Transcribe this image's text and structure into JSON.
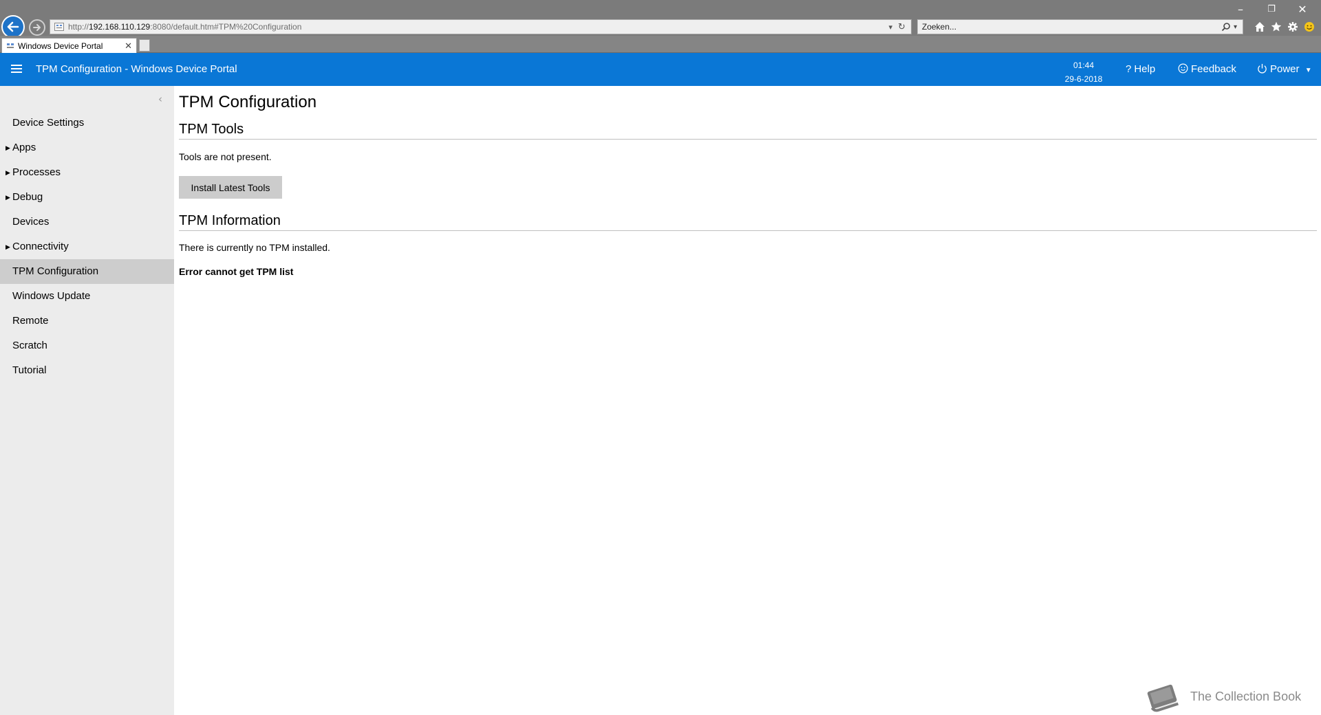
{
  "browser": {
    "url_prefix": "http://",
    "url_host": "192.168.110.129",
    "url_rest": ":8080/default.htm#TPM%20Configuration",
    "search_placeholder": "Zoeken...",
    "tab_title": "Windows Device Portal",
    "window_controls": {
      "minimize": "–",
      "restore": "❐",
      "close": "✕"
    },
    "toolbar_icons": [
      "home-icon",
      "star-icon",
      "gear-icon",
      "smiley-icon"
    ]
  },
  "header": {
    "title": "TPM Configuration - Windows Device Portal",
    "time": "01:44",
    "date": "29-6-2018",
    "help_label": "Help",
    "feedback_label": "Feedback",
    "power_label": "Power",
    "accent_color": "#0a77d6"
  },
  "sidebar": {
    "items": [
      {
        "label": "Device Settings",
        "expandable": false,
        "active": false
      },
      {
        "label": "Apps",
        "expandable": true,
        "active": false
      },
      {
        "label": "Processes",
        "expandable": true,
        "active": false
      },
      {
        "label": "Debug",
        "expandable": true,
        "active": false
      },
      {
        "label": "Devices",
        "expandable": false,
        "active": false
      },
      {
        "label": "Connectivity",
        "expandable": true,
        "active": false
      },
      {
        "label": "TPM Configuration",
        "expandable": false,
        "active": true
      },
      {
        "label": "Windows Update",
        "expandable": false,
        "active": false
      },
      {
        "label": "Remote",
        "expandable": false,
        "active": false
      },
      {
        "label": "Scratch",
        "expandable": false,
        "active": false
      },
      {
        "label": "Tutorial",
        "expandable": false,
        "active": false
      }
    ]
  },
  "main": {
    "page_title": "TPM Configuration",
    "tools_heading": "TPM Tools",
    "tools_status": "Tools are not present.",
    "install_button": "Install Latest Tools",
    "info_heading": "TPM Information",
    "tpm_status": "There is currently no TPM installed.",
    "tpm_error": "Error cannot get TPM list"
  },
  "watermark": {
    "text": "The Collection Book"
  }
}
